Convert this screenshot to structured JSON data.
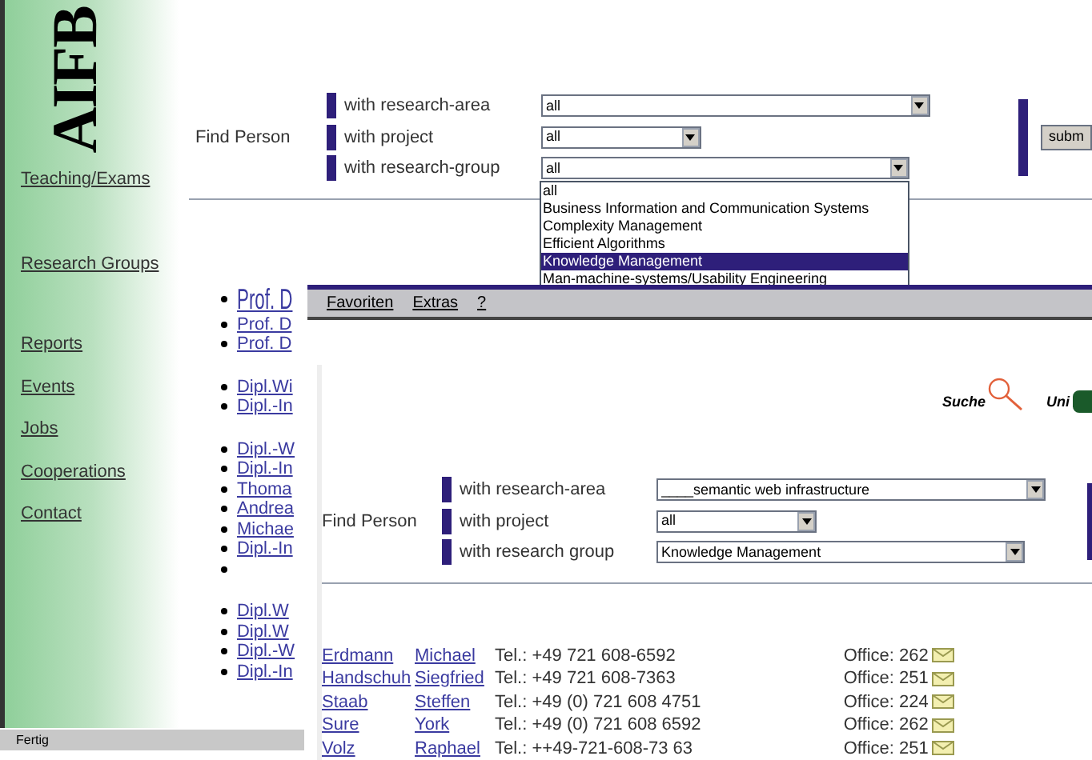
{
  "back_window": {
    "logo": "AIFB",
    "nav": [
      {
        "label": "Teaching/Exams"
      },
      {
        "label": "Research Groups"
      },
      {
        "label": "Reports"
      },
      {
        "label": "Events"
      },
      {
        "label": "Jobs"
      },
      {
        "label": "Cooperations"
      },
      {
        "label": "Contact"
      }
    ],
    "find_person": {
      "title": "Find Person",
      "fields": [
        {
          "label": "with research-area",
          "value": "all"
        },
        {
          "label": "with project",
          "value": "all"
        },
        {
          "label": "with research-group",
          "value": "all"
        }
      ],
      "submit": "subm"
    },
    "dropdown_options": [
      {
        "label": "all",
        "selected": false
      },
      {
        "label": "Business Information and Communication Systems",
        "selected": false
      },
      {
        "label": "Complexity Management",
        "selected": false
      },
      {
        "label": "Efficient Algorithms",
        "selected": false
      },
      {
        "label": "Knowledge Management",
        "selected": true
      },
      {
        "label": "Man-machine-systems/Usability Engineering",
        "selected": false
      }
    ],
    "people_groups": [
      [
        {
          "kind": "link",
          "label": "Prof. D"
        },
        {
          "kind": "link",
          "label": "Prof. D"
        },
        {
          "kind": "link",
          "label": "Prof. D"
        }
      ],
      [
        {
          "kind": "link",
          "label": "Dipl.Wi"
        },
        {
          "kind": "link",
          "label": "Dipl.-In"
        }
      ],
      [
        {
          "kind": "link",
          "label": "Dipl.-W"
        },
        {
          "kind": "link",
          "label": "Dipl.-In"
        },
        {
          "kind": "link",
          "label": "Thoma"
        },
        {
          "kind": "link",
          "label": "Andrea"
        },
        {
          "kind": "link",
          "label": "Michae"
        },
        {
          "kind": "link",
          "label": "Dipl.-In"
        },
        {
          "kind": "blank"
        }
      ],
      [
        {
          "kind": "link",
          "label": "Dipl.W"
        },
        {
          "kind": "link",
          "label": "Dipl.W"
        },
        {
          "kind": "link",
          "label": "Dipl.-W"
        },
        {
          "kind": "link",
          "label": "Dipl.-In"
        }
      ]
    ],
    "status_bar": "Fertig"
  },
  "front_window": {
    "menu": [
      "Favoriten",
      "Extras",
      "?"
    ],
    "search_label": "Suche",
    "uni_label": "Uni",
    "find_person": {
      "title": "Find Person",
      "fields": [
        {
          "label": "with research-area",
          "value": "____semantic web infrastructure"
        },
        {
          "label": "with project",
          "value": "all"
        },
        {
          "label": "with research group",
          "value": "Knowledge Management"
        }
      ]
    },
    "people": [
      {
        "last": "Erdmann",
        "first": "Michael",
        "tel": "Tel.: +49 721 608-6592",
        "office": "Office: 262"
      },
      {
        "last": "Handschuh",
        "first": "Siegfried",
        "tel": "Tel.: +49 721 608-7363",
        "office": "Office: 251"
      },
      {
        "last": "Staab",
        "first": "Steffen",
        "tel": "Tel.: +49 (0) 721 608 4751",
        "office": "Office: 224"
      },
      {
        "last": "Sure",
        "first": "York",
        "tel": "Tel.: +49 (0) 721 608 6592",
        "office": "Office: 262"
      },
      {
        "last": "Volz",
        "first": "Raphael",
        "tel": "Tel.: ++49-721-608-73 63",
        "office": "Office: 251"
      }
    ]
  }
}
